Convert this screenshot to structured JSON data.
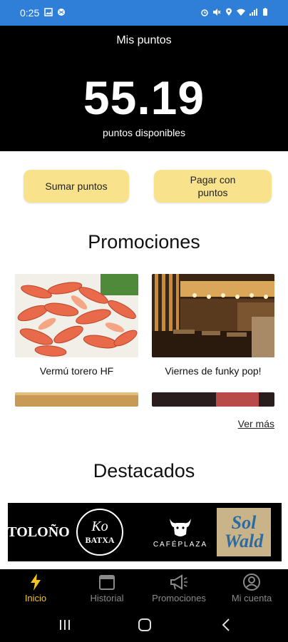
{
  "status_bar": {
    "time": "0:25"
  },
  "header": {
    "title": "Mis puntos",
    "points_value": "55.19",
    "points_label": "puntos disponibles"
  },
  "actions": {
    "add_points": "Sumar puntos",
    "pay_with_points_line1": "Pagar con",
    "pay_with_points_line2": "puntos"
  },
  "promotions": {
    "title": "Promociones",
    "items": [
      {
        "caption": "Vermú torero HF",
        "icon": "shrimp-photo"
      },
      {
        "caption": "Viernes de funky pop!",
        "icon": "bar-interior-photo"
      }
    ],
    "see_more": "Ver más"
  },
  "featured": {
    "title": "Destacados",
    "logos": [
      {
        "name": "TOLOÑO"
      },
      {
        "name_line1": "Ko",
        "name_line2": "BATXA"
      },
      {
        "name": "CAFÉPLAZA"
      },
      {
        "name_line1": "Sol",
        "name_line2": "Wald"
      }
    ]
  },
  "bottom_nav": {
    "items": [
      {
        "label": "Inicio",
        "icon": "lightning-icon",
        "active": true
      },
      {
        "label": "Historial",
        "icon": "calendar-icon",
        "active": false
      },
      {
        "label": "Promociones",
        "icon": "megaphone-icon",
        "active": false
      },
      {
        "label": "Mi cuenta",
        "icon": "user-icon",
        "active": false
      }
    ]
  },
  "colors": {
    "status_bar": "#2f7fd8",
    "hero_bg": "#000000",
    "button_bg": "#f8e38c",
    "nav_active": "#f5c518",
    "nav_inactive": "#8a8a8a"
  }
}
